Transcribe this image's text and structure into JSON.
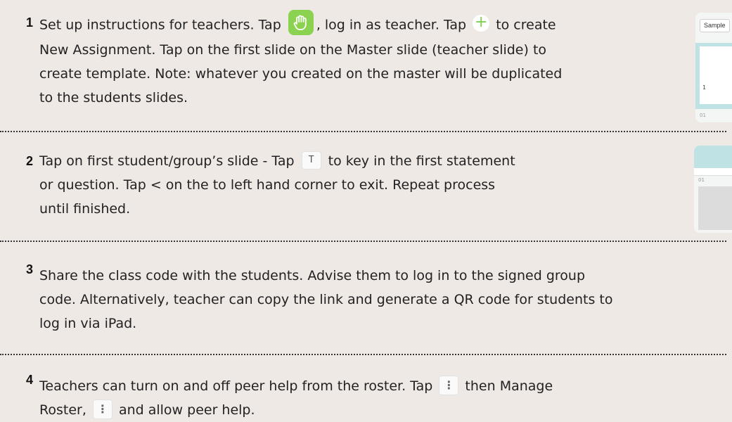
{
  "steps": [
    {
      "number": "1",
      "line1_part1": "Set up instructions for teachers. Tap ",
      "line1_part2": ", log in as teacher. Tap ",
      "line1_part3": " to create",
      "line2": "New Assignment.   Tap on the first slide on the Master slide (teacher slide) to",
      "line3": "create template. Note: whatever you created on the master will be duplicated",
      "line4": "to the students slides.",
      "plus_glyph": "+"
    },
    {
      "number": "2",
      "line1_part1": "Tap on first student/group’s slide - Tap ",
      "line1_part2": " to key in the first statement",
      "line2": "or question. Tap <  on the to left hand corner to exit. Repeat process",
      "line3": "until finished.",
      "t_glyph": "T"
    },
    {
      "number": "3",
      "line1": "Share the class code with the students. Advise them to log in to the signed group",
      "line2": "code. Alternatively, teacher can copy the link and generate a QR code for students to",
      "line3": "log in via iPad."
    },
    {
      "number": "4",
      "line1_part1": "Teachers can turn on and off peer help from the roster. Tap ",
      "line1_part2": " then Manage",
      "line2_part1": "Roster, ",
      "line2_part2": " and allow peer help.",
      "more_glyph": "⋮"
    }
  ],
  "thumbnails": {
    "slide_preview_1": {
      "tab_label": "Sample",
      "slide_number": "1",
      "index_label": "01"
    },
    "slide_preview_2": {
      "index_label": "01"
    }
  },
  "colors": {
    "background": "#efe9e6",
    "hand_button": "#8ad24f",
    "plus_accent": "#7ed04f",
    "thumbnail_band": "#bfe3e4"
  },
  "icons": [
    "raise-hand-icon",
    "plus-icon",
    "text-tool-icon",
    "more-options-icon"
  ]
}
